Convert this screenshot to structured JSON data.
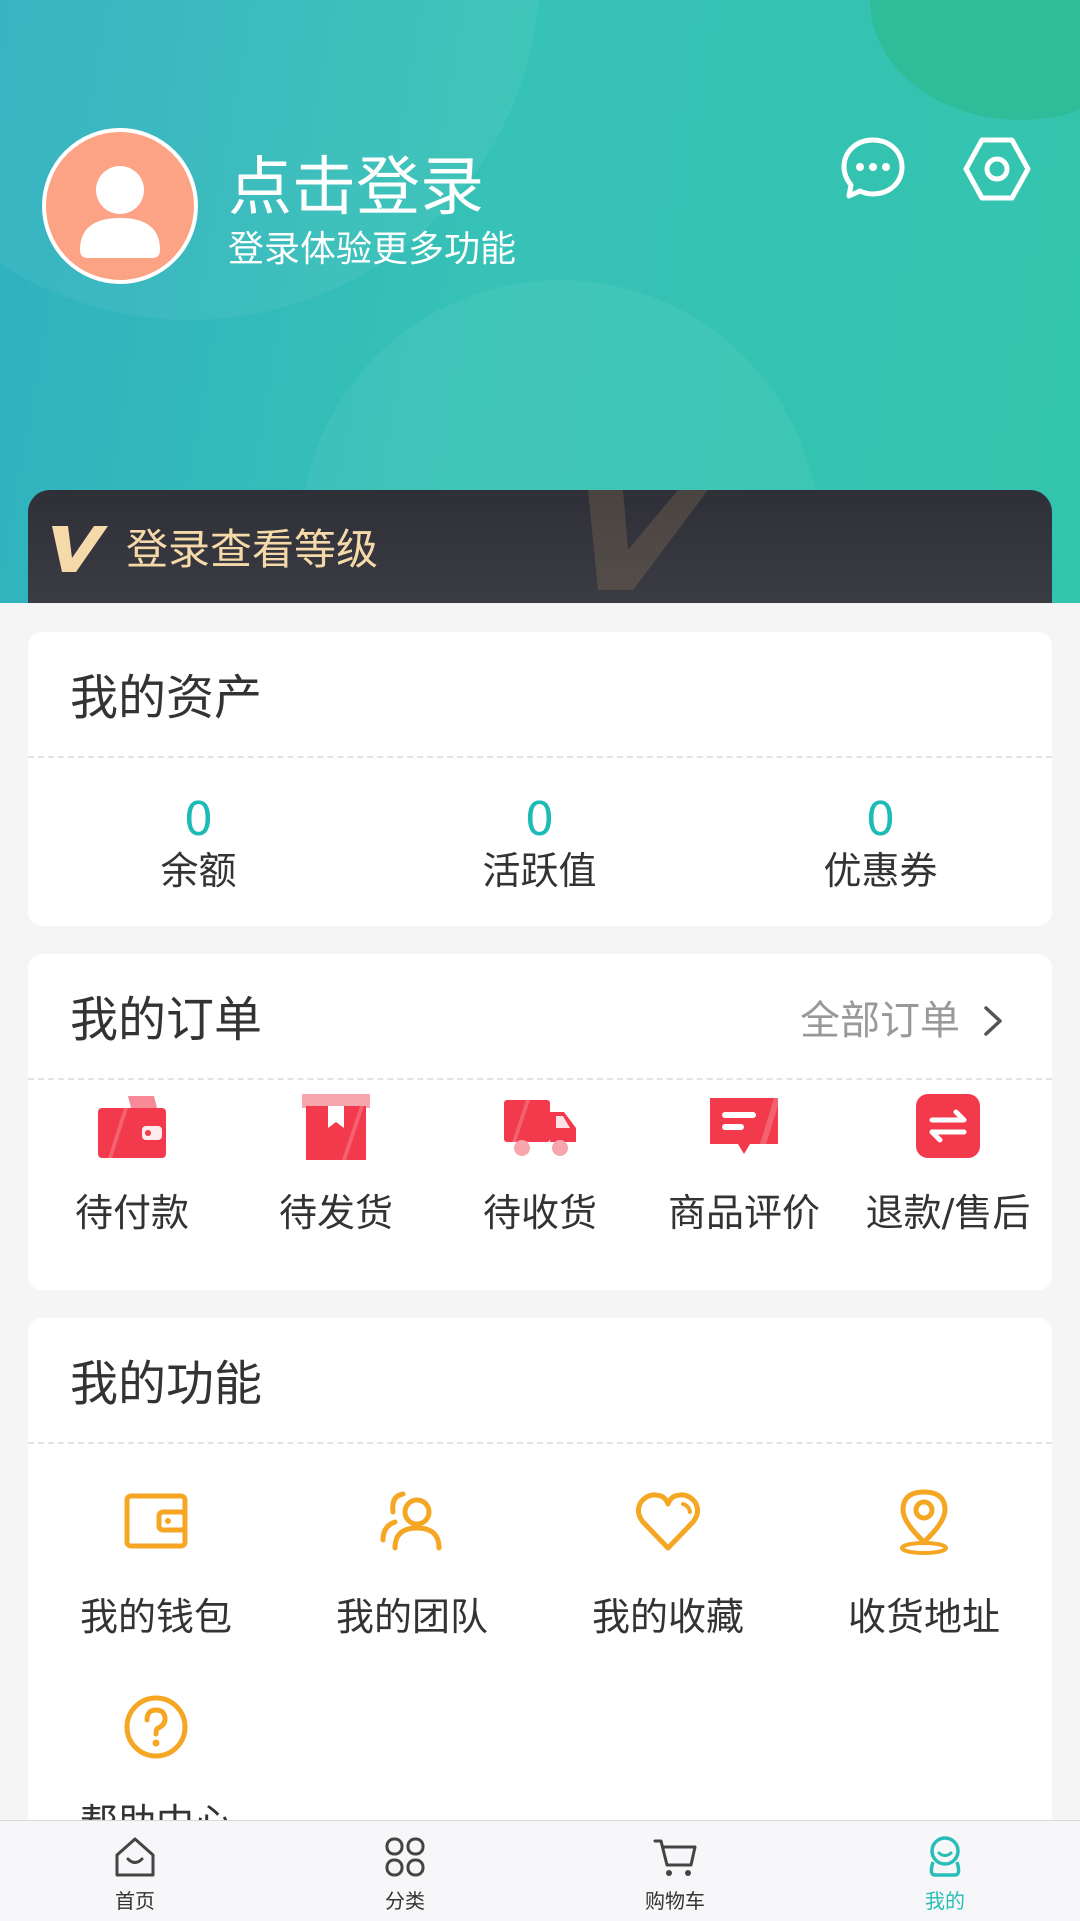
{
  "header": {
    "login_title": "点击登录",
    "login_subtitle": "登录体验更多功能",
    "avatar_icon": "user-avatar-icon",
    "message_icon": "chat-bubble-icon",
    "settings_icon": "hex-gear-icon"
  },
  "vip": {
    "text": "登录查看等级"
  },
  "assets": {
    "title": "我的资产",
    "items": [
      {
        "value": "0",
        "label": "余额"
      },
      {
        "value": "0",
        "label": "活跃值"
      },
      {
        "value": "0",
        "label": "优惠券"
      }
    ]
  },
  "orders": {
    "title": "我的订单",
    "all_label": "全部订单",
    "items": [
      {
        "label": "待付款",
        "icon": "wallet-icon"
      },
      {
        "label": "待发货",
        "icon": "package-icon"
      },
      {
        "label": "待收货",
        "icon": "truck-icon"
      },
      {
        "label": "商品评价",
        "icon": "comment-icon"
      },
      {
        "label": "退款/售后",
        "icon": "exchange-icon"
      }
    ]
  },
  "functions": {
    "title": "我的功能",
    "items": [
      {
        "label": "我的钱包",
        "icon": "wallet-outline-icon"
      },
      {
        "label": "我的团队",
        "icon": "team-icon"
      },
      {
        "label": "我的收藏",
        "icon": "heart-icon"
      },
      {
        "label": "收货地址",
        "icon": "location-icon"
      },
      {
        "label": "帮助中心",
        "icon": "help-icon"
      }
    ]
  },
  "tabbar": {
    "items": [
      {
        "label": "首页",
        "icon": "home-icon"
      },
      {
        "label": "分类",
        "icon": "category-icon"
      },
      {
        "label": "购物车",
        "icon": "cart-icon"
      },
      {
        "label": "我的",
        "icon": "profile-icon",
        "active": true
      }
    ]
  },
  "colors": {
    "brand_teal": "#36c2b6",
    "asset_value": "#1dbbb5",
    "order_red": "#f23a4c",
    "function_orange": "#f5a623",
    "vip_gold": "#f6d9a8",
    "tab_active": "#28bdb7"
  }
}
